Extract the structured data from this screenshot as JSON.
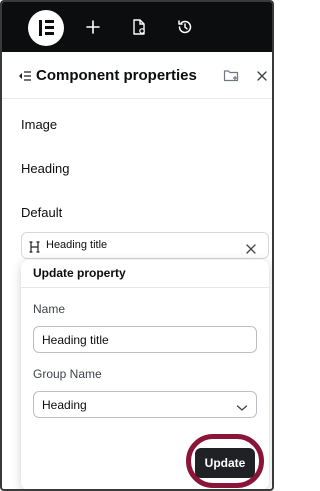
{
  "topbar": {
    "icons": [
      "elementor-logo-icon",
      "plus-icon",
      "page-settings-icon",
      "history-icon"
    ]
  },
  "panel": {
    "title": "Component properties",
    "header_icons": [
      "component-list-icon",
      "new-folder-icon",
      "close-icon"
    ]
  },
  "sections": {
    "image": "Image",
    "heading": "Heading",
    "default": "Default"
  },
  "property_chip": {
    "icon": "heading-icon",
    "label": "Heading title"
  },
  "popover": {
    "title": "Update property",
    "name_label": "Name",
    "name_value": "Heading title",
    "group_label": "Group Name",
    "group_value": "Heading",
    "update_label": "Update"
  },
  "colors": {
    "topbar": "#0c0d0e",
    "highlight_ring": "#8a1538",
    "button": "#1f2124"
  }
}
